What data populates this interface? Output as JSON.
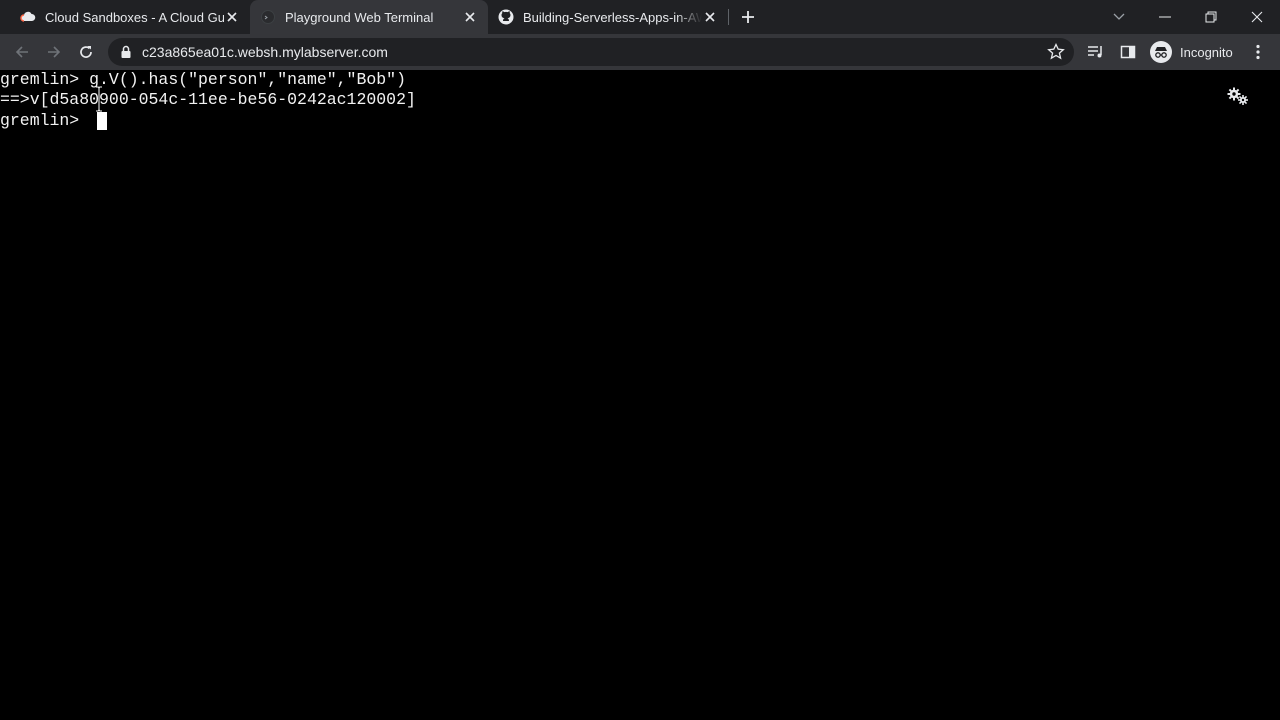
{
  "browser": {
    "tabs": [
      {
        "title": "Cloud Sandboxes - A Cloud Guru",
        "active": false,
        "icon": "cloud-icon"
      },
      {
        "title": "Playground Web Terminal",
        "active": true,
        "icon": "terminal-globe-icon"
      },
      {
        "title": "Building-Serverless-Apps-in-AWS",
        "active": false,
        "icon": "github-icon"
      }
    ],
    "url": "c23a865ea01c.websh.mylabserver.com",
    "profile_label": "Incognito"
  },
  "terminal": {
    "lines": [
      "gremlin> g.V().has(\"person\",\"name\",\"Bob\")",
      "==>v[d5a80900-054c-11ee-be56-0242ac120002]",
      "gremlin> "
    ]
  },
  "colors": {
    "tabstrip_bg": "#202124",
    "toolbar_bg": "#35363a",
    "terminal_bg": "#000000",
    "terminal_fg": "#f2f2f2"
  }
}
